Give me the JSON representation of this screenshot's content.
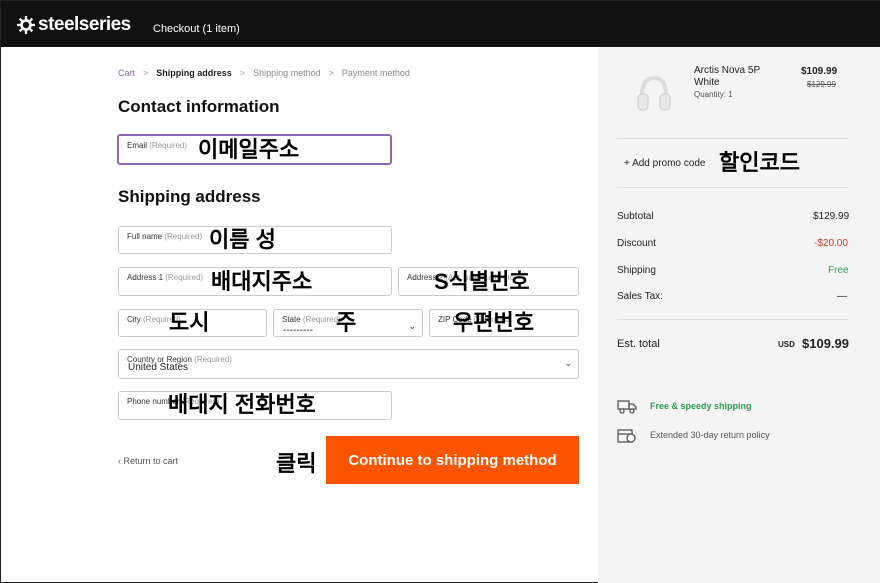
{
  "header": {
    "brand": "steelseries",
    "checkout_title": "Checkout (1 item)"
  },
  "breadcrumb": {
    "cart": "Cart",
    "shipping_address": "Shipping address",
    "shipping_method": "Shipping method",
    "payment_method": "Payment method",
    "sep": ">"
  },
  "contact": {
    "title": "Contact information",
    "email_label": "Email",
    "email_required": "(Required)",
    "email_overlay": "이메일주소"
  },
  "shipping": {
    "title": "Shipping address",
    "full_name_label": "Full name",
    "full_name_required": "(Required)",
    "full_name_overlay": "이름 성",
    "address1_label": "Address 1",
    "address1_required": "(Required)",
    "address1_overlay": "배대지주소",
    "address2_label": "Address 2",
    "address2_hint": "(Apt, suite, unit, etc)",
    "address2_overlay": "S식별번호",
    "city_label": "City",
    "city_required": "(Required)",
    "city_overlay": "도시",
    "state_label": "State",
    "state_required": "(Required)",
    "state_value": "---------",
    "state_overlay": "주",
    "zip_label": "ZIP Code",
    "zip_required": "(Required)",
    "zip_overlay": "우편번호",
    "country_label": "Country or Region",
    "country_required": "(Required)",
    "country_value": "United States",
    "phone_label": "Phone number",
    "phone_required": "(Required)",
    "phone_overlay": "배대지 전화번호"
  },
  "actions": {
    "return": "‹ Return to cart",
    "click_overlay": "클릭",
    "continue": "Continue to shipping method"
  },
  "order": {
    "product_name_line1": "Arctis Nova 5P",
    "product_name_line2": "White",
    "quantity": "Quantity: 1",
    "price": "$109.99",
    "original_price": "$129.99",
    "promo": "+ Add promo code",
    "promo_overlay": "할인코드",
    "subtotal_label": "Subtotal",
    "subtotal_value": "$129.99",
    "discount_label": "Discount",
    "discount_value": "-$20.00",
    "shipping_label": "Shipping",
    "shipping_value": "Free",
    "tax_label": "Sales Tax:",
    "tax_value": "—",
    "total_label": "Est. total",
    "total_currency": "USD",
    "total_value": "$109.99",
    "perk1": "Free & speedy shipping",
    "perk2": "Extended 30-day return policy"
  },
  "colors": {
    "accent": "#fa5400",
    "focus": "#8a6ab0",
    "discount": "#c0392b",
    "free": "#2e9e4f",
    "header": "#111111"
  },
  "icons": [
    "steelseries-logo-icon",
    "truck-icon",
    "return-box-icon",
    "chevron-down-icon",
    "info-icon"
  ]
}
